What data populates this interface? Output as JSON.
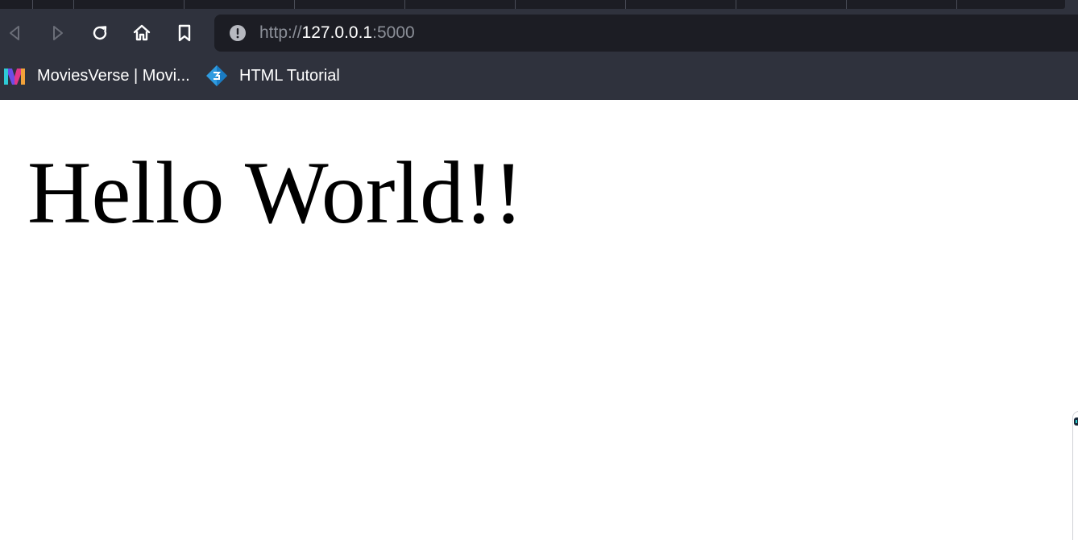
{
  "toolbar": {
    "url_scheme": "http://",
    "url_host": "127.0.0.1",
    "url_port": ":5000",
    "icons": [
      "back-icon",
      "forward-icon",
      "reload-icon",
      "home-icon",
      "bookmark-icon",
      "site-info-icon"
    ]
  },
  "bookmarks": [
    {
      "label": "MoviesVerse | Movi...",
      "icon": "moviesverse-logo-icon"
    },
    {
      "label": "HTML Tutorial",
      "icon": "w3schools-logo-icon"
    }
  ],
  "page": {
    "heading": "Hello World!!"
  },
  "colors": {
    "chrome_bg": "#2f323d",
    "urlbar_bg": "#1c1d24",
    "url_dim": "#8b8f98",
    "text_light": "#ffffff",
    "page_bg": "#ffffff"
  }
}
